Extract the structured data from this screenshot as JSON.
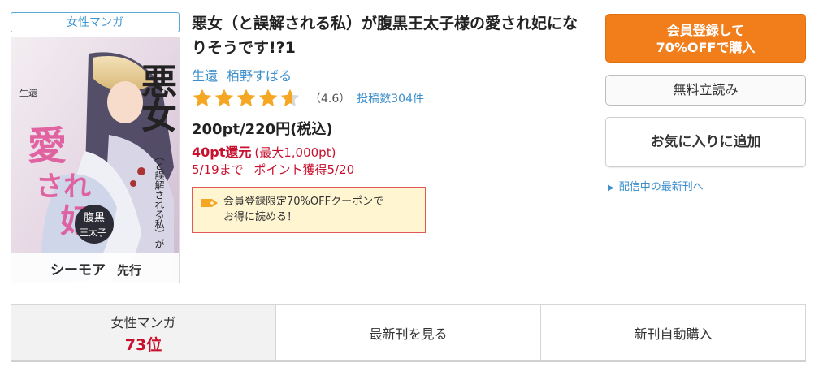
{
  "genre_badge": "女性マンガ",
  "book": {
    "title": "悪女（と誤解される私）が腹黒王太子様の愛され妃になりそうです!?1",
    "authors": [
      "生還",
      "栢野すばる"
    ],
    "rating": {
      "value": 4.6,
      "value_label": "（4.6）",
      "review_count": "投稿数304件"
    },
    "price": "200pt/220円(税込)",
    "points_return": "40pt還元",
    "points_max": "(最大1,000pt)",
    "deadline": "5/19まで",
    "points_grant": "ポイント獲得5/20",
    "coupon": "会員登録限定70%OFFクーポンで\nお得に読める！"
  },
  "cover": {
    "title_chars": "悪女",
    "small_text": "（と誤解される私）が",
    "big_text": "愛され妃に",
    "author_label": "生還",
    "publisher": "コミック シーモア 先行",
    "seal": "腹黒王太子様の"
  },
  "actions": {
    "buy": "会員登録して\n70%OFFで購入",
    "read_free": "無料立読み",
    "favorite": "お気に入りに追加",
    "latest_link": "配信中の最新刊へ"
  },
  "tabs": {
    "genre_label": "女性マンガ",
    "genre_rank": "73位",
    "see_latest": "最新刊を見る",
    "auto_purchase": "新刊自動購入"
  },
  "colors": {
    "accent_orange": "#f27e1b",
    "link_blue": "#3b8ecb",
    "price_red": "#c8102e",
    "star_gold": "#f5a623"
  }
}
